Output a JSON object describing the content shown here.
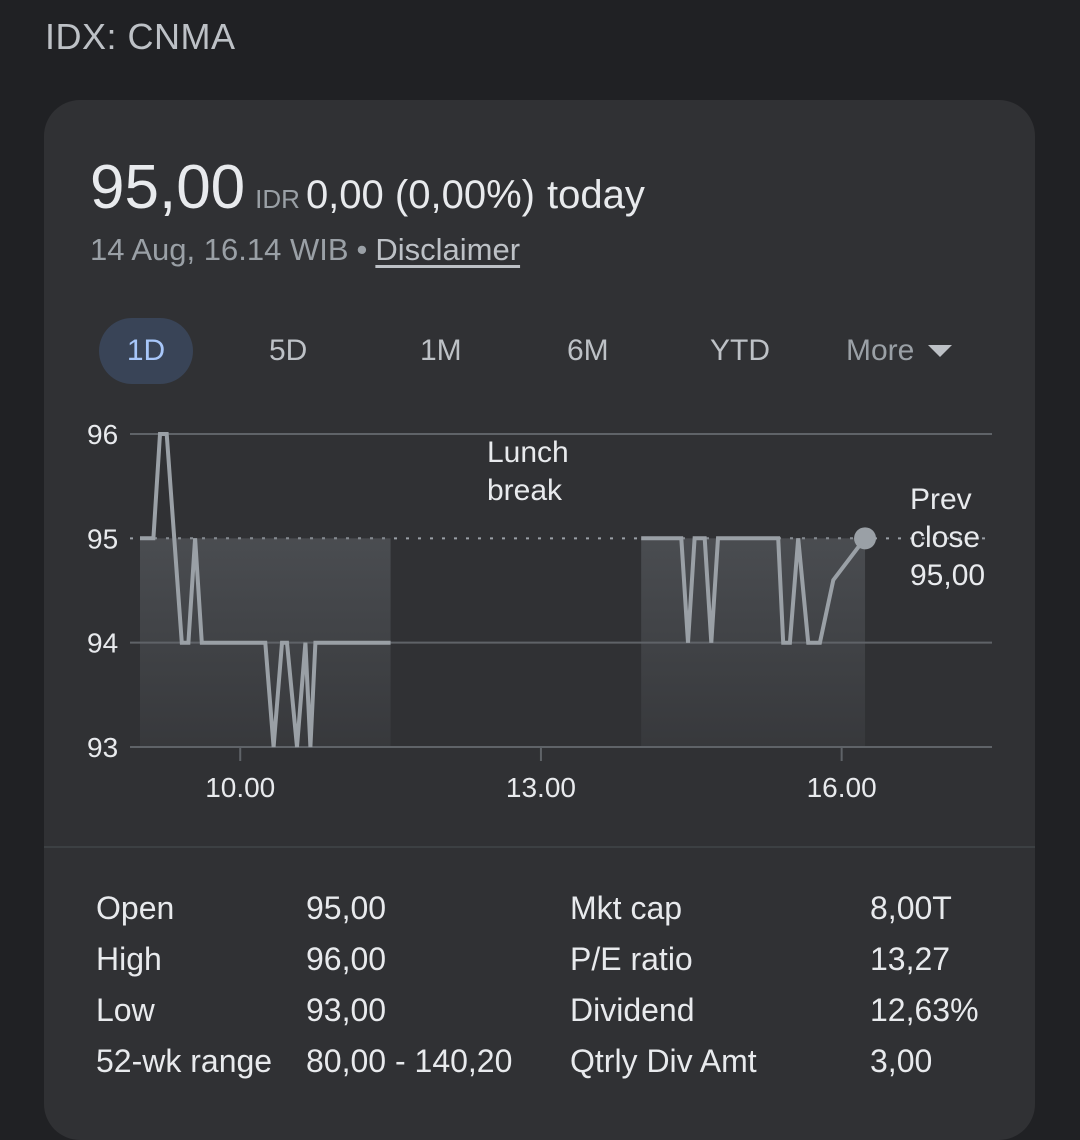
{
  "header": {
    "ticker": "IDX: CNMA"
  },
  "quote": {
    "price": "95,00",
    "currency": "IDR",
    "change": "0,00 (0,00%)",
    "change_suffix": "today",
    "timestamp": "14 Aug, 16.14 WIB",
    "separator": "•",
    "disclaimer": "Disclaimer"
  },
  "ranges": [
    {
      "label": "1D",
      "active": true
    },
    {
      "label": "5D",
      "active": false
    },
    {
      "label": "1M",
      "active": false
    },
    {
      "label": "6M",
      "active": false
    },
    {
      "label": "YTD",
      "active": false
    },
    {
      "label": "More",
      "active": false
    }
  ],
  "chart_data": {
    "type": "line",
    "ylim": [
      93,
      96
    ],
    "y_ticks": [
      "96",
      "95",
      "94",
      "93"
    ],
    "x_ticks": [
      "10.00",
      "13.00",
      "16.00"
    ],
    "annotations": {
      "lunch_break": [
        "Lunch",
        "break"
      ],
      "prev_close": [
        "Prev",
        "close",
        "95,00"
      ]
    },
    "prev_close": 95,
    "colors": {
      "line": "#9aa0a6",
      "grid": "#5f6368",
      "fill": "#5f6368"
    },
    "series": [
      {
        "segment": "morning",
        "x": [
          "09.00",
          "09.08",
          "09.12",
          "09.16",
          "09.25",
          "09.29",
          "09.33",
          "09.37",
          "09.41",
          "09.52",
          "10.00",
          "10.08",
          "10.15",
          "10.20",
          "10.25",
          "10.28",
          "10.34",
          "10.39",
          "10.42",
          "10.45",
          "10.50",
          "10.55",
          "11.00",
          "11.10",
          "11.20",
          "11.30"
        ],
        "y": [
          95,
          95,
          96,
          96,
          94,
          94,
          95,
          94,
          94,
          94,
          94,
          94,
          94,
          93,
          94,
          94,
          93,
          94,
          93,
          94,
          94,
          94,
          94,
          94,
          94,
          94
        ]
      },
      {
        "segment": "afternoon",
        "x": [
          "14.00",
          "14.20",
          "14.24",
          "14.28",
          "14.32",
          "14.38",
          "14.42",
          "14.46",
          "15.00",
          "15.15",
          "15.22",
          "15.25",
          "15.29",
          "15.34",
          "15.40",
          "15.47",
          "15.55",
          "16.14"
        ],
        "y": [
          95,
          95,
          95,
          94,
          95,
          95,
          94,
          95,
          95,
          95,
          95,
          94,
          94,
          95,
          94,
          94,
          94.6,
          95
        ]
      }
    ]
  },
  "stats": [
    {
      "label": "Open",
      "value": "95,00",
      "label2": "Mkt cap",
      "value2": "8,00T"
    },
    {
      "label": "High",
      "value": "96,00",
      "label2": "P/E ratio",
      "value2": "13,27"
    },
    {
      "label": "Low",
      "value": "93,00",
      "label2": "Dividend",
      "value2": "12,63%"
    },
    {
      "label": "52-wk range",
      "value": "80,00 - 140,20",
      "label2": "Qtrly Div Amt",
      "value2": "3,00"
    }
  ]
}
